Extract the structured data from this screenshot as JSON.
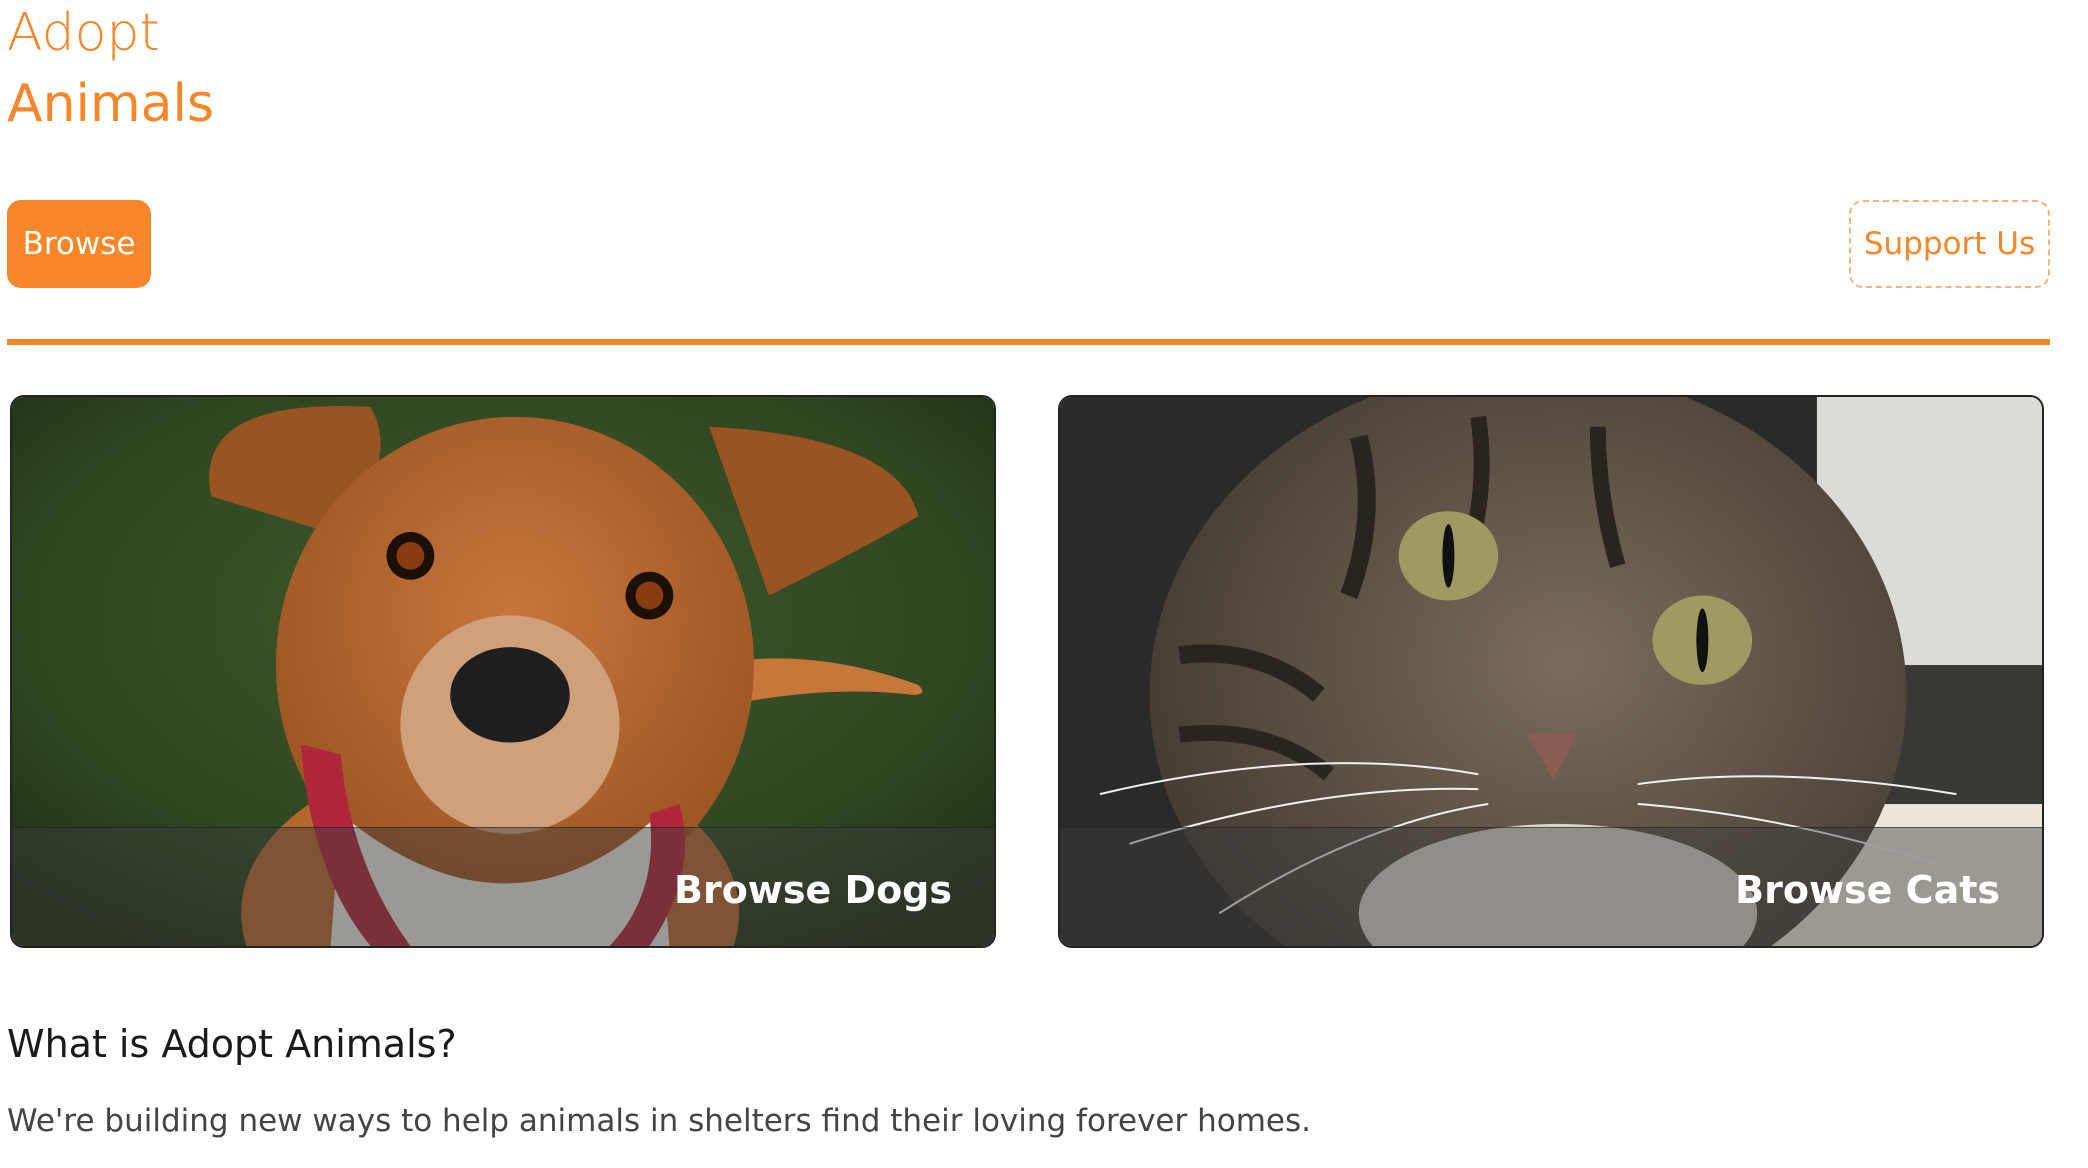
{
  "header": {
    "logo_line1": "Adopt",
    "logo_line2": "Animals"
  },
  "nav": {
    "browse_label": "Browse",
    "support_label": "Support Us"
  },
  "cards": [
    {
      "label": "Browse Dogs",
      "image": "dog-photo"
    },
    {
      "label": "Browse Cats",
      "image": "cat-photo"
    }
  ],
  "about": {
    "heading": "What is Adopt Animals?",
    "body": "We're building new ways to help animals in shelters find their loving forever homes."
  },
  "colors": {
    "accent": "#f98629",
    "text_dark": "#1a1a1a",
    "text_body": "#444444"
  }
}
